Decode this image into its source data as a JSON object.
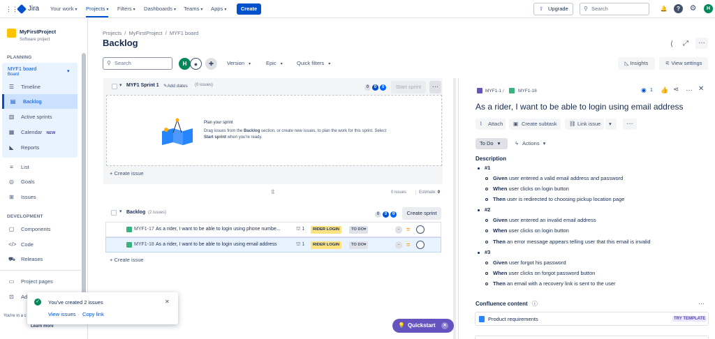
{
  "topnav": {
    "brand": "Jira",
    "items": [
      "Your work",
      "Projects",
      "Filters",
      "Dashboards",
      "Teams",
      "Apps"
    ],
    "create": "Create",
    "upgrade": "Upgrade",
    "search_placeholder": "Search",
    "avatar": "H"
  },
  "sidebar": {
    "project_name": "MyFirstProject",
    "project_type": "Software project",
    "planning_label": "PLANNING",
    "board_name": "MYF1 board",
    "board_sub": "Board",
    "planning_items": [
      "Timeline",
      "Backlog",
      "Active sprints",
      "Calendar",
      "Reports"
    ],
    "new_badge": "NEW",
    "other_items": [
      "List",
      "Goals",
      "Issues"
    ],
    "development_label": "DEVELOPMENT",
    "dev_items": [
      "Components",
      "Code",
      "Releases"
    ],
    "project_pages": "Project pages",
    "add_partial": "Add",
    "footer_partial": "You're in a c",
    "learn_more": "Learn more"
  },
  "main": {
    "breadcrumb": [
      "Projects",
      "MyFirstProject",
      "MYF1 board"
    ],
    "title": "Backlog",
    "search_placeholder": "Search",
    "avatar_initial": "H",
    "filters": [
      "Version",
      "Epic",
      "Quick filters"
    ],
    "insights": "Insights",
    "view_settings": "View settings",
    "sprint": {
      "name": "MYF1 Sprint 1",
      "add_dates": "Add dates",
      "issue_count": "(0 issues)",
      "counts": [
        "0",
        "0",
        "0"
      ],
      "start_sprint": "Start sprint",
      "plan_title": "Plan your sprint",
      "plan_text_1": "Drag issues from the ",
      "plan_bold_1": "Backlog",
      "plan_text_2": " section, or create new issues, to plan the work for this sprint. Select",
      "plan_bold_2": "Start sprint",
      "plan_text_3": " when you're ready.",
      "create_issue": "+ Create issue",
      "footer_issues": "0 issues",
      "estimate_label": "Estimate:",
      "estimate_value": "0"
    },
    "backlog": {
      "name": "Backlog",
      "issue_count": "(2 issues)",
      "counts": [
        "0",
        "0",
        "0"
      ],
      "create_sprint": "Create sprint",
      "create_issue": "+ Create issue",
      "rows": [
        {
          "key": "MYF1-17",
          "summary": "As a rider, I want to be able to login using phone numbe...",
          "children": "1",
          "epic": "RIDER LOGIN",
          "status": "TO DO",
          "estimate": "-"
        },
        {
          "key": "MYF1-18",
          "summary": "As a rider, I want to be able to login using email address",
          "children": "1",
          "epic": "RIDER LOGIN",
          "status": "TO DO",
          "estimate": "-"
        }
      ]
    }
  },
  "detail": {
    "parent_key": "MYF1-1",
    "key": "MYF1-18",
    "watch_count": "1",
    "title": "As a rider, I want to be able to login using email address",
    "attach": "Attach",
    "create_subtask": "Create subtask",
    "link_issue": "Link issue",
    "status": "To Do",
    "actions": "Actions",
    "description_label": "Description",
    "description": [
      {
        "heading": "#1",
        "items": [
          {
            "b": "Given",
            "t": " user entered a valid email address and password"
          },
          {
            "b": "When",
            "t": " user clicks on login button"
          },
          {
            "b": "Then",
            "t": " user is redirected to choosing pickup location page"
          }
        ]
      },
      {
        "heading": "#2",
        "items": [
          {
            "b": "Given",
            "t": " user entered an invalid email address"
          },
          {
            "b": "When",
            "t": " user clicks on login button"
          },
          {
            "b": "Then",
            "t": " an error message appears telling user that this email is invalid"
          }
        ]
      },
      {
        "heading": "#3",
        "items": [
          {
            "b": "Given",
            "t": " user forgot his password"
          },
          {
            "b": "When",
            "t": " user clicks on forgot password button"
          },
          {
            "b": "Then",
            "t": " an email with a recovery link is sent to the user"
          }
        ]
      }
    ],
    "confluence_label": "Confluence content",
    "confluence_item": "Product requirements",
    "try_template": "TRY TEMPLATE"
  },
  "toast": {
    "message": "You've created 2 issues",
    "view_issues": "View issues",
    "copy_link": "Copy link"
  },
  "quickstart": "Quickstart",
  "colors": {
    "accent": "#0052cc",
    "story": "#36b37e",
    "epic": "#ffe380",
    "quickstart": "#6554c0"
  }
}
